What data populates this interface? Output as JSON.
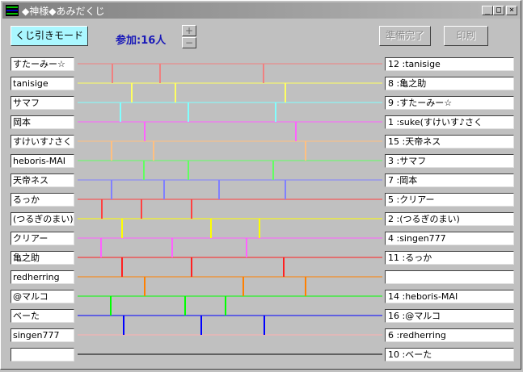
{
  "window": {
    "title": "◆神様◆あみだくじ"
  },
  "titlebar_buttons": {
    "minimize": "_",
    "maximize": "□",
    "close": "×"
  },
  "toolbar": {
    "mode_label": "くじ引きモード",
    "count_label": "参加:16人",
    "plus": "+",
    "minus": "−",
    "ready_label": "準備完了",
    "print_label": "印刷"
  },
  "participants": [
    "すたーみー☆",
    "tanisige",
    "サマフ",
    "岡本",
    "すけいす♪さく",
    "heboris-MAI",
    "天帝ネス",
    "るっか",
    "(つるぎのまい)",
    "クリアー",
    "亀之助",
    "redherring",
    "@マルコ",
    "ベーた",
    "singen777",
    ""
  ],
  "results": [
    "12 :tanisige",
    "8 :亀之助",
    "9 :すたーみー☆",
    "1 :suke(すけいす♪さく",
    "15 :天帝ネス",
    "3 :サマフ",
    "7 :岡本",
    "5 :クリアー",
    "2 :(つるぎのまい)",
    "4 :singen777",
    "11 :るっか",
    "",
    "14 :heboris-MAI",
    "16 :@マルコ",
    "6 :redherring",
    "10 :ベーた"
  ],
  "line_colors": [
    "#f08080",
    "#ffff60",
    "#80ffff",
    "#ff60ff",
    "#ffc080",
    "#60ff60",
    "#8080ff",
    "#ff4040",
    "#ffff00",
    "#ff60ff",
    "#ff2020",
    "#ff8000",
    "#00ff00",
    "#0000ff",
    "#ffb0b0",
    "#000000"
  ]
}
